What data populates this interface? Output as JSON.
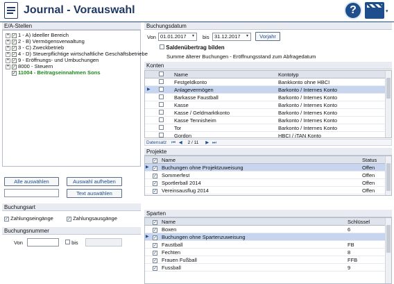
{
  "window": {
    "title": "Journal - Vorauswahl",
    "help_icon": "question-mark-icon",
    "clapper_icon": "clapperboard-icon"
  },
  "ea_stellen": {
    "label": "E/A-Stellen",
    "items": [
      {
        "text": "1 - A) Ideeller Bereich",
        "checked": true,
        "expand": "+"
      },
      {
        "text": "2 - B) Vermögensverwaltung",
        "checked": true,
        "expand": "+"
      },
      {
        "text": "3 - C) Zweckbetrieb",
        "checked": true,
        "expand": "+"
      },
      {
        "text": "4 - D) Steuerpflichtige wirtschaftliche Geschäftsbetriebe",
        "checked": true,
        "expand": "+"
      },
      {
        "text": "9 - Eröffnungs- und Umbuchungen",
        "checked": true,
        "expand": "+"
      },
      {
        "text": "8000 - Steuern",
        "checked": true,
        "expand": "+"
      },
      {
        "text": "11004 - Beitragseinnahmen Sons",
        "checked": true,
        "expand": ""
      }
    ]
  },
  "buttons": {
    "select_all": "Alle auswählen",
    "deselect": "Auswahl aufheben",
    "select_text": "Text auswählen"
  },
  "buchungsart": {
    "label": "Buchungsart",
    "in": "Zahlungseingänge",
    "out": "Zahlungsausgänge"
  },
  "buchungsnummer": {
    "label": "Buchungsnummer",
    "von": "Von",
    "bis": "bis",
    "von_value": "",
    "bis_value": ""
  },
  "buchungsdatum": {
    "label": "Buchungsdatum",
    "von": "Von",
    "von_value": "01.01.2017",
    "bis": "bis",
    "bis_value": "31.12.2017",
    "vorjahr": "Vorjahr",
    "saldo": "Saldenübertrag bilden",
    "summe": "Summe älterer Buchungen - Eröffnungsstand zum Abfragedatum"
  },
  "konten": {
    "label": "Konten",
    "columns": [
      "Name",
      "Kontotyp"
    ],
    "rows": [
      {
        "name": "Festgeldkonto",
        "type": "Bankkonto ohne HBCI",
        "selected": false
      },
      {
        "name": "Anlagevermögen",
        "type": "Barkonto / Internes Konto",
        "selected": true
      },
      {
        "name": "Barkasse Faustball",
        "type": "Barkonto / Internes Konto",
        "selected": false
      },
      {
        "name": "Kasse",
        "type": "Barkonto / Internes Konto",
        "selected": false
      },
      {
        "name": "Kasse / Geldmarktkonto",
        "type": "Barkonto / Internes Konto",
        "selected": false
      },
      {
        "name": "Kasse Tennisheim",
        "type": "Barkonto / Internes Konto",
        "selected": false
      },
      {
        "name": "Tor",
        "type": "Barkonto / Internes Konto",
        "selected": false
      },
      {
        "name": "Gordon",
        "type": "HBCI / iTAN Konto",
        "selected": false
      }
    ],
    "nav": {
      "label": "Datensatz",
      "page": "2",
      "total": "11"
    }
  },
  "projekte": {
    "label": "Projekte",
    "columns": [
      "Name",
      "Status"
    ],
    "rows": [
      {
        "name": "Buchungen ohne Projektzuweisung",
        "status": "Offen",
        "selected": true
      },
      {
        "name": "Sommerfest",
        "status": "Offen",
        "selected": false
      },
      {
        "name": "Sportlerball 2014",
        "status": "Offen",
        "selected": false
      },
      {
        "name": "Vereinsausflug 2014",
        "status": "Offen",
        "selected": false
      }
    ]
  },
  "sparten": {
    "label": "Sparten",
    "columns": [
      "Name",
      "Schlüssel"
    ],
    "rows": [
      {
        "name": "Boxen",
        "key": "6",
        "selected": false
      },
      {
        "name": "Buchungen ohne Spartenzuweisung",
        "key": "",
        "selected": true
      },
      {
        "name": "Faustball",
        "key": "FB",
        "selected": false
      },
      {
        "name": "Fechten",
        "key": "8",
        "selected": false
      },
      {
        "name": "Frauen Fußball",
        "key": "FFB",
        "selected": false
      },
      {
        "name": "Fussball",
        "key": "9",
        "selected": false
      }
    ]
  }
}
